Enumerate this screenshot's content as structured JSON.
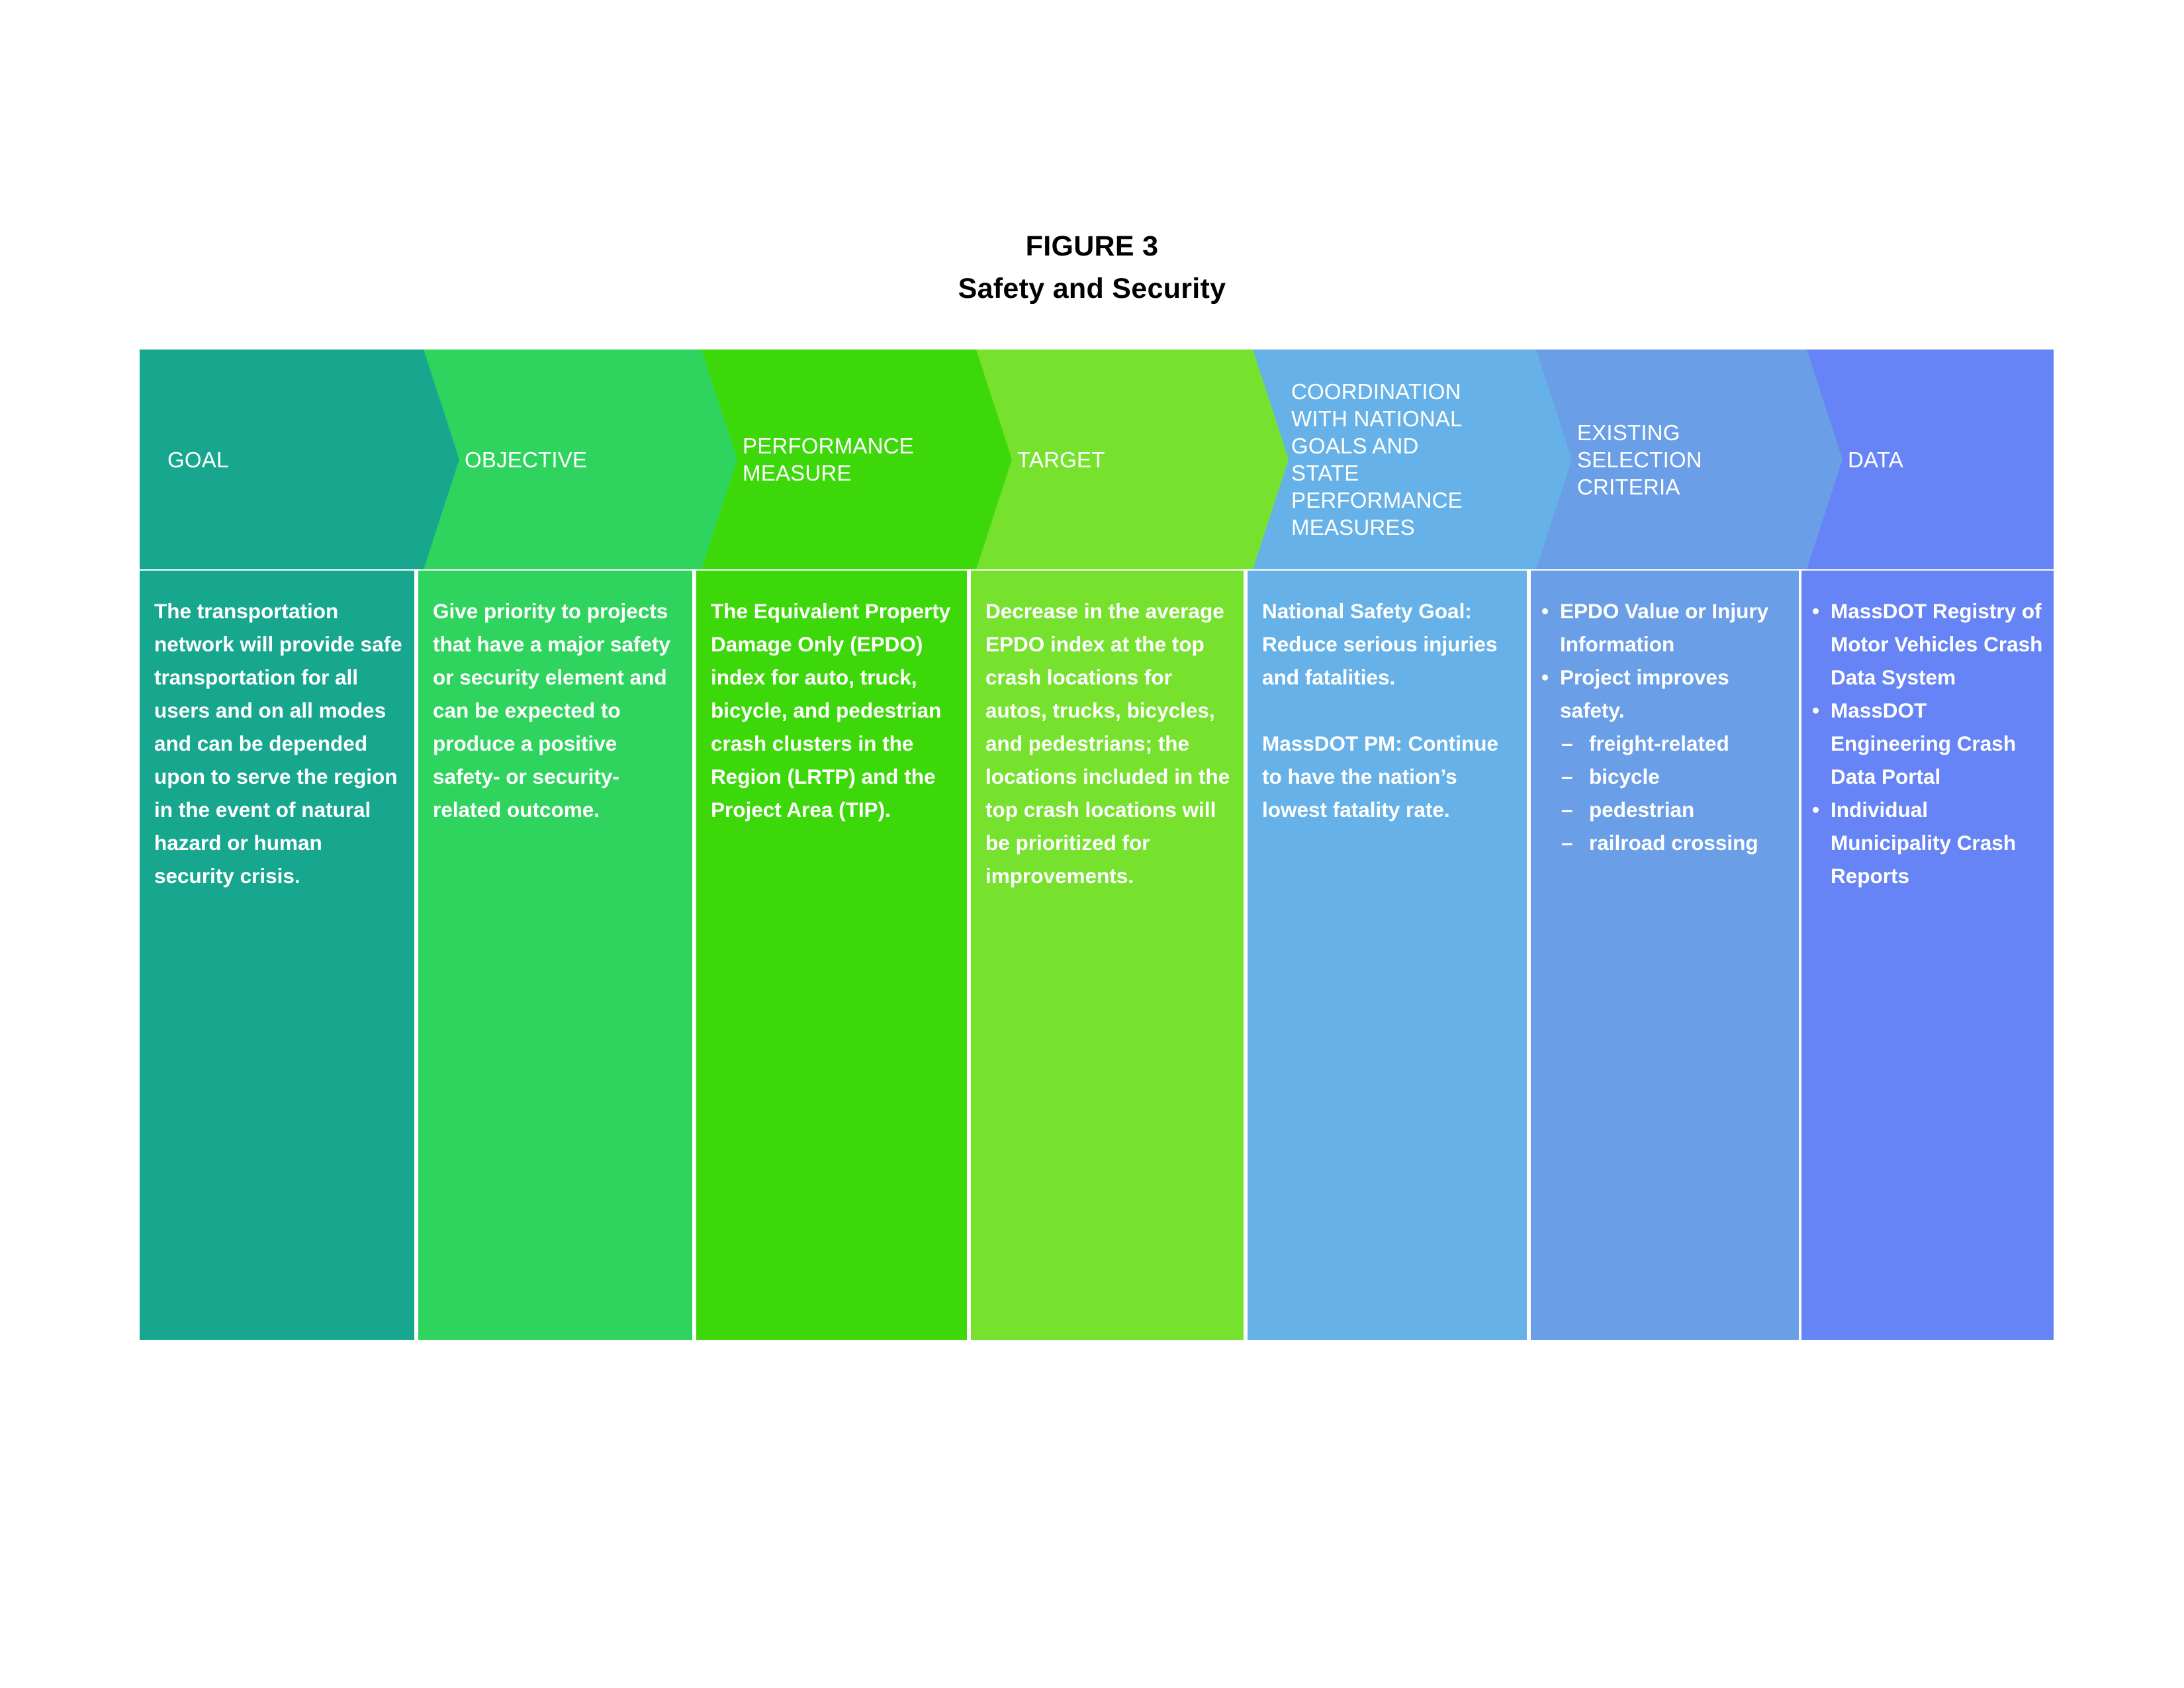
{
  "figure": {
    "title_line1": "FIGURE 3",
    "title_line2": "Safety and Security"
  },
  "colors": {
    "goal": "#17a78f",
    "objective": "#2fd45e",
    "performance_measure": "#3dd80a",
    "target": "#76e22e",
    "coordination": "#66b2e8",
    "existing_selection_criteria": "#6a9fe8",
    "data": "#6684f5",
    "text": "#ffffff",
    "title_text": "#000000",
    "page_background": "#ffffff",
    "divider": "#ffffff"
  },
  "headers": [
    {
      "label": "GOAL"
    },
    {
      "label": "OBJECTIVE"
    },
    {
      "label": "PERFORMANCE\nMEASURE"
    },
    {
      "label": "TARGET"
    },
    {
      "label": "COORDINATION\nWITH NATIONAL\nGOALS AND\nSTATE\nPERFORMANCE\nMEASURES"
    },
    {
      "label": "EXISTING\nSELECTION\nCRITERIA"
    },
    {
      "label": "DATA"
    }
  ],
  "body": {
    "goal": {
      "text": "The transportation network will provide safe transportation for all users and on all modes and can be depended upon to serve the region in the event of natural hazard or human security crisis."
    },
    "objective": {
      "text": "Give priority to projects that have a major safety or security element and can be expected to produce a positive safety- or security-related outcome."
    },
    "performance_measure": {
      "text": "The Equivalent Property Damage Only (EPDO) index for auto, truck, bicycle, and pedestrian crash clusters in the Region (LRTP) and the Project Area (TIP)."
    },
    "target": {
      "text": "Decrease in the average EPDO index at the top crash locations for autos, trucks, bicycles, and pedestrians; the locations included in the top crash locations will be prioritized for improvements."
    },
    "coordination": {
      "paragraph1": "National Safety Goal: Reduce serious injuries and fatalities.",
      "paragraph2": "MassDOT PM: Continue to have the nation’s lowest fatality rate."
    },
    "existing_selection_criteria": {
      "bullets": [
        {
          "text": "EPDO Value or Injury Information",
          "sub": []
        },
        {
          "text": "Project improves safety.",
          "sub": [
            "freight-related",
            "bicycle",
            "pedestrian",
            "railroad crossing"
          ]
        }
      ]
    },
    "data": {
      "bullets": [
        {
          "text": "MassDOT Registry of Motor Vehicles Crash Data System"
        },
        {
          "text": "MassDOT Engineering Crash Data Portal"
        },
        {
          "text": "Individual Municipality Crash Reports"
        }
      ]
    }
  }
}
